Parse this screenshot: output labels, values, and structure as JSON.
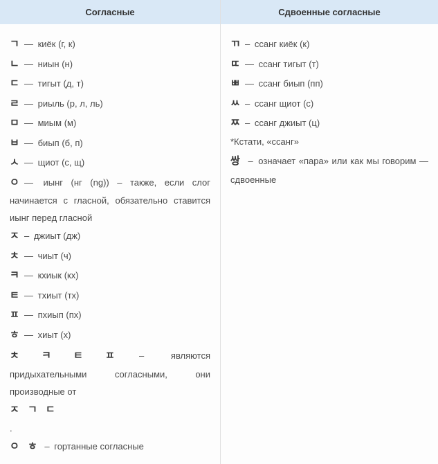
{
  "left": {
    "header": "Согласные",
    "rows": [
      {
        "glyph": "ㄱ",
        "sep": "—",
        "text": "киёк (г, к)"
      },
      {
        "glyph": "ㄴ",
        "sep": "—",
        "text": "ниын (н)"
      },
      {
        "glyph": "ㄷ",
        "sep": "—",
        "text": "тигыт (д, т)"
      },
      {
        "glyph": "ㄹ",
        "sep": "—",
        "text": "риыль (р, л, ль)"
      },
      {
        "glyph": "ㅁ",
        "sep": "—",
        "text": "миым (м)"
      },
      {
        "glyph": "ㅂ",
        "sep": "—",
        "text": "биып (б, п)"
      },
      {
        "glyph": "ㅅ",
        "sep": "—",
        "text": "щиот (с, щ)"
      },
      {
        "glyph": "ㅇ",
        "sep": "—",
        "text": "иынг (нг (ng)) – также, если слог начинается с гласной, обязательно ставится иынг перед гласной"
      },
      {
        "glyph": "ㅈ",
        "sep": "–",
        "text": "джиыт (дж)"
      },
      {
        "glyph": "ㅊ",
        "sep": "—",
        "text": "чиыт (ч)"
      },
      {
        "glyph": "ㅋ",
        "sep": "—",
        "text": "кхиык (кх)"
      },
      {
        "glyph": "ㅌ",
        "sep": "—",
        "text": "тхиыт (тх)"
      },
      {
        "glyph": "ㅍ",
        "sep": "—",
        "text": "пхиып (пх)"
      },
      {
        "glyph": "ㅎ",
        "sep": "—",
        "text": "хиыт (х)"
      }
    ],
    "note1_glyphs": [
      "ㅊ",
      "ㅋ",
      "ㅌ",
      "ㅍ"
    ],
    "note1_sep": "–",
    "note1_text": "являются придыхательными согласными, они производные от",
    "note1_from": "ㅈ ㄱ ㄷ",
    "dot": ".",
    "note2_glyphs": "ㅇ ㅎ",
    "note2_sep": "–",
    "note2_text": "гортанные согласные"
  },
  "right": {
    "header": "Сдвоенные согласные",
    "rows": [
      {
        "glyph": "ㄲ",
        "sep": "–",
        "text": "ссанг киёк (к)"
      },
      {
        "glyph": "ㄸ",
        "sep": "—",
        "text": "ссанг тигыт (т)"
      },
      {
        "glyph": "ㅃ",
        "sep": "—",
        "text": "ссанг биып (пп)"
      },
      {
        "glyph": "ㅆ",
        "sep": "–",
        "text": "ссанг щиот (с)"
      },
      {
        "glyph": "ㅉ",
        "sep": "–",
        "text": "ссанг джиыт (ц)"
      }
    ],
    "aside1": "*Кстати, «ссанг»",
    "aside2_glyph": "쌍",
    "aside2_sep": "–",
    "aside2_text": "означает «пара» или как мы говорим — сдвоенные"
  }
}
